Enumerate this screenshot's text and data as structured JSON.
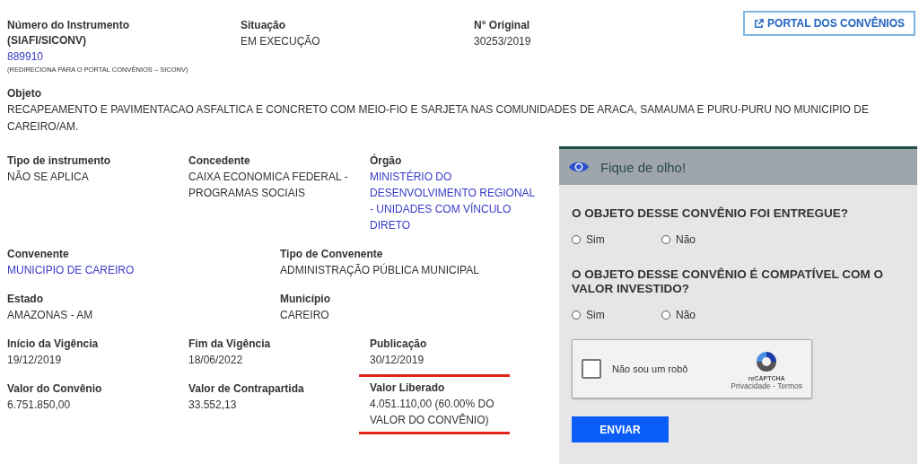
{
  "header_fields": [
    {
      "label": "Número do Instrumento (SIAFI/SICONV)",
      "value": "889910",
      "kind": "link",
      "note": "(REDIRECIONA PARA O PORTAL CONVÊNIOS – SICONV)"
    },
    {
      "label": "Situação",
      "value": "EM EXECUÇÃO",
      "kind": "plain"
    },
    {
      "label": "N° Original",
      "value": "30253/2019",
      "kind": "plain"
    }
  ],
  "portal_button": {
    "label": "PORTAL DOS CONVÊNIOS"
  },
  "objeto": {
    "label": "Objeto",
    "value": "RECAPEAMENTO E PAVIMENTACAO ASFALTICA E CONCRETO COM MEIO-FIO E SARJETA NAS COMUNIDADES DE ARACA, SAMAUMA E PURU-PURU NO MUNICIPIO DE CAREIRO/AM."
  },
  "rows": [
    {
      "fields": [
        {
          "label": "Tipo de instrumento",
          "value": "NÃO SE APLICA",
          "kind": "plain"
        },
        {
          "label": "Concedente",
          "value": "CAIXA ECONOMICA FEDERAL - PROGRAMAS SOCIAIS",
          "kind": "plain"
        },
        {
          "label": "Órgão",
          "value": "MINISTÉRIO DO DESENVOLVIMENTO REGIONAL - UNIDADES COM VÍNCULO DIRETO",
          "kind": "link"
        }
      ]
    },
    {
      "fields": [
        {
          "label": "Convenente",
          "value": "MUNICIPIO DE CAREIRO",
          "kind": "link"
        },
        {
          "label": "Tipo de Convenente",
          "value": "ADMINISTRAÇÃO PÚBLICA MUNICIPAL",
          "kind": "plain"
        }
      ]
    },
    {
      "fields": [
        {
          "label": "Estado",
          "value": "AMAZONAS - AM",
          "kind": "plain"
        },
        {
          "label": "Município",
          "value": "CAREIRO",
          "kind": "plain"
        }
      ]
    },
    {
      "fields": [
        {
          "label": "Início da Vigência",
          "value": "19/12/2019",
          "kind": "plain"
        },
        {
          "label": "Fim da Vigência",
          "value": "18/06/2022",
          "kind": "plain"
        },
        {
          "label": "Publicação",
          "value": "30/12/2019",
          "kind": "plain"
        }
      ]
    },
    {
      "fields": [
        {
          "label": "Valor do Convênio",
          "value": "6.751.850,00",
          "kind": "plain"
        },
        {
          "label": "Valor de Contrapartida",
          "value": "33.552,13",
          "kind": "plain"
        },
        {
          "label": "Valor Liberado",
          "value": "4.051.110,00 (60.00% DO VALOR DO CONVÊNIO)",
          "kind": "plain",
          "highlighted": true
        }
      ]
    }
  ],
  "panel": {
    "title": "Fique de olho!",
    "questions": [
      {
        "text": "O OBJETO DESSE CONVÊNIO FOI ENTREGUE?",
        "options": [
          {
            "label": "Sim",
            "selected": false
          },
          {
            "label": "Não",
            "selected": false
          }
        ]
      },
      {
        "text": "O OBJETO DESSE CONVÊNIO É COMPATÍVEL COM O VALOR INVESTIDO?",
        "options": [
          {
            "label": "Sim",
            "selected": false
          },
          {
            "label": "Não",
            "selected": false
          }
        ]
      }
    ],
    "captcha": {
      "label": "Não sou um robô",
      "checked": false,
      "brand": "reCAPTCHA",
      "links": "Privacidade - Termos"
    },
    "submit": "ENVIAR"
  }
}
